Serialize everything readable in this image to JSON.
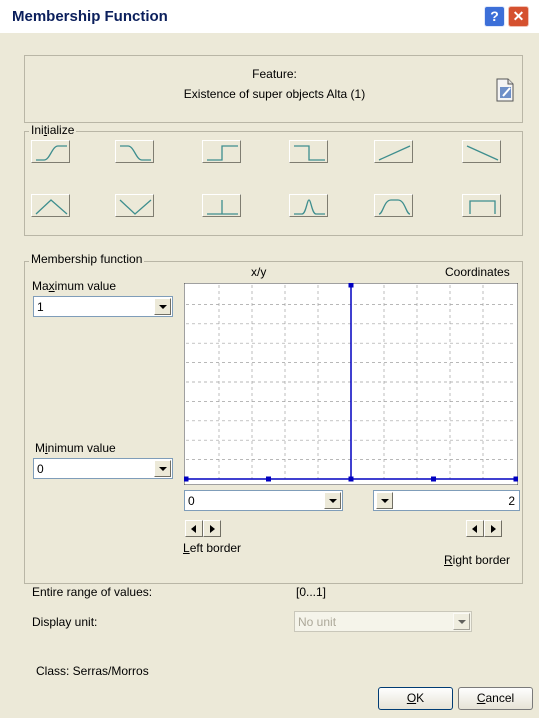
{
  "window": {
    "title": "Membership Function"
  },
  "feature": {
    "label": "Feature:",
    "name": "Existence of super objects Alta (1)",
    "icon": "edit-document-icon"
  },
  "initialize": {
    "legend_pre": "Ini",
    "legend_key": "t",
    "legend_post": "ialize",
    "buttons": [
      {
        "name": "larger-than-smooth",
        "icon": "s-curve-rising-icon"
      },
      {
        "name": "smaller-than-smooth",
        "icon": "s-curve-falling-icon"
      },
      {
        "name": "larger-than-step",
        "icon": "step-rising-icon"
      },
      {
        "name": "smaller-than-step",
        "icon": "step-falling-icon"
      },
      {
        "name": "linear-rising",
        "icon": "linear-rising-icon"
      },
      {
        "name": "linear-falling",
        "icon": "linear-falling-icon"
      },
      {
        "name": "triangle",
        "icon": "triangle-icon"
      },
      {
        "name": "inverted-triangle",
        "icon": "inverted-triangle-icon"
      },
      {
        "name": "singleton",
        "icon": "singleton-icon"
      },
      {
        "name": "approximate-gaussian",
        "icon": "gaussian-icon"
      },
      {
        "name": "about-range",
        "icon": "about-range-icon"
      },
      {
        "name": "full-range",
        "icon": "full-range-icon"
      }
    ]
  },
  "membership": {
    "legend": "Membership function",
    "xy_label": "x/y",
    "coordinates_label": "Coordinates",
    "max_label_pre": "Ma",
    "max_label_key": "x",
    "max_label_post": "imum value",
    "max_value": "1",
    "min_label_pre": "M",
    "min_label_key": "i",
    "min_label_post": "nimum value",
    "min_value": "0",
    "left_border_value": "0",
    "right_border_value": "2",
    "left_border_key": "L",
    "left_border_rest": "eft border",
    "right_border_key": "R",
    "right_border_rest": "ight border"
  },
  "chart_data": {
    "type": "line",
    "x": [
      0,
      0.5,
      1,
      1,
      1,
      1.5,
      2
    ],
    "y": [
      0,
      0,
      0,
      1,
      0,
      0,
      0
    ],
    "xlim": [
      0,
      2
    ],
    "ylim": [
      0,
      1
    ],
    "grid": true,
    "line_color": "#0000c0"
  },
  "range": {
    "label": "Entire range of values:",
    "value": "[0...1]"
  },
  "unit": {
    "label": "Display unit:",
    "value": "No unit"
  },
  "class_info": {
    "text": "Class: Serras/Morros"
  },
  "buttons": {
    "ok_key": "O",
    "ok_rest": "K",
    "cancel_key": "C",
    "cancel_rest": "ancel"
  },
  "colors": {
    "accent": "#0b1f5c",
    "teal": "#3e8e8e",
    "curve": "#0000c0"
  }
}
